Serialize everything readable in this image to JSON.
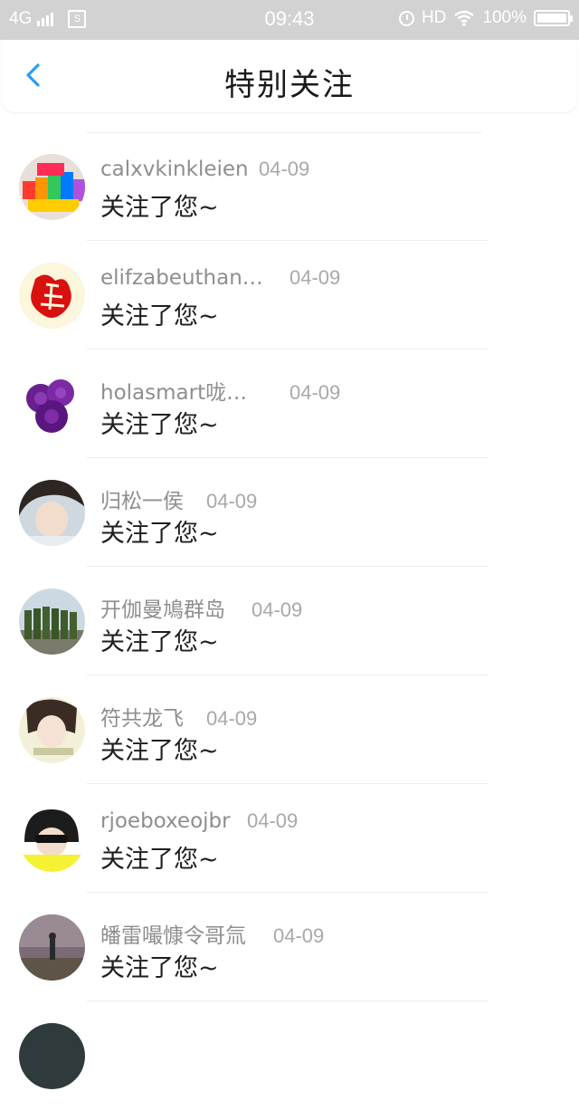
{
  "status_bar": {
    "network": "4G",
    "sim_label": "S",
    "time": "09:43",
    "hd": "HD",
    "battery": "100%",
    "icons": [
      "signal-icon",
      "sim-icon",
      "alarm-icon",
      "wifi-icon",
      "battery-icon"
    ]
  },
  "nav": {
    "title": "特别关注",
    "back_icon": "chevron-left-icon",
    "accent_color": "#2a9df4"
  },
  "items": [
    {
      "name": "calxvkinkleien",
      "date": "04-09",
      "message": "关注了您~"
    },
    {
      "name": "elifzabeuthan…",
      "date": "04-09",
      "message": "关注了您~"
    },
    {
      "name": "holasmart咙…",
      "date": "04-09",
      "message": "关注了您~"
    },
    {
      "name": "归松一侯",
      "date": "04-09",
      "message": "关注了您~"
    },
    {
      "name": "开伽曼鳩群岛",
      "date": "04-09",
      "message": "关注了您~"
    },
    {
      "name": "符共龙飞",
      "date": "04-09",
      "message": "关注了您~"
    },
    {
      "name": "rjoeboxeojbr",
      "date": "04-09",
      "message": "关注了您~"
    },
    {
      "name": "皤雷嘬慷令哥氚",
      "date": "04-09",
      "message": "关注了您~"
    }
  ]
}
